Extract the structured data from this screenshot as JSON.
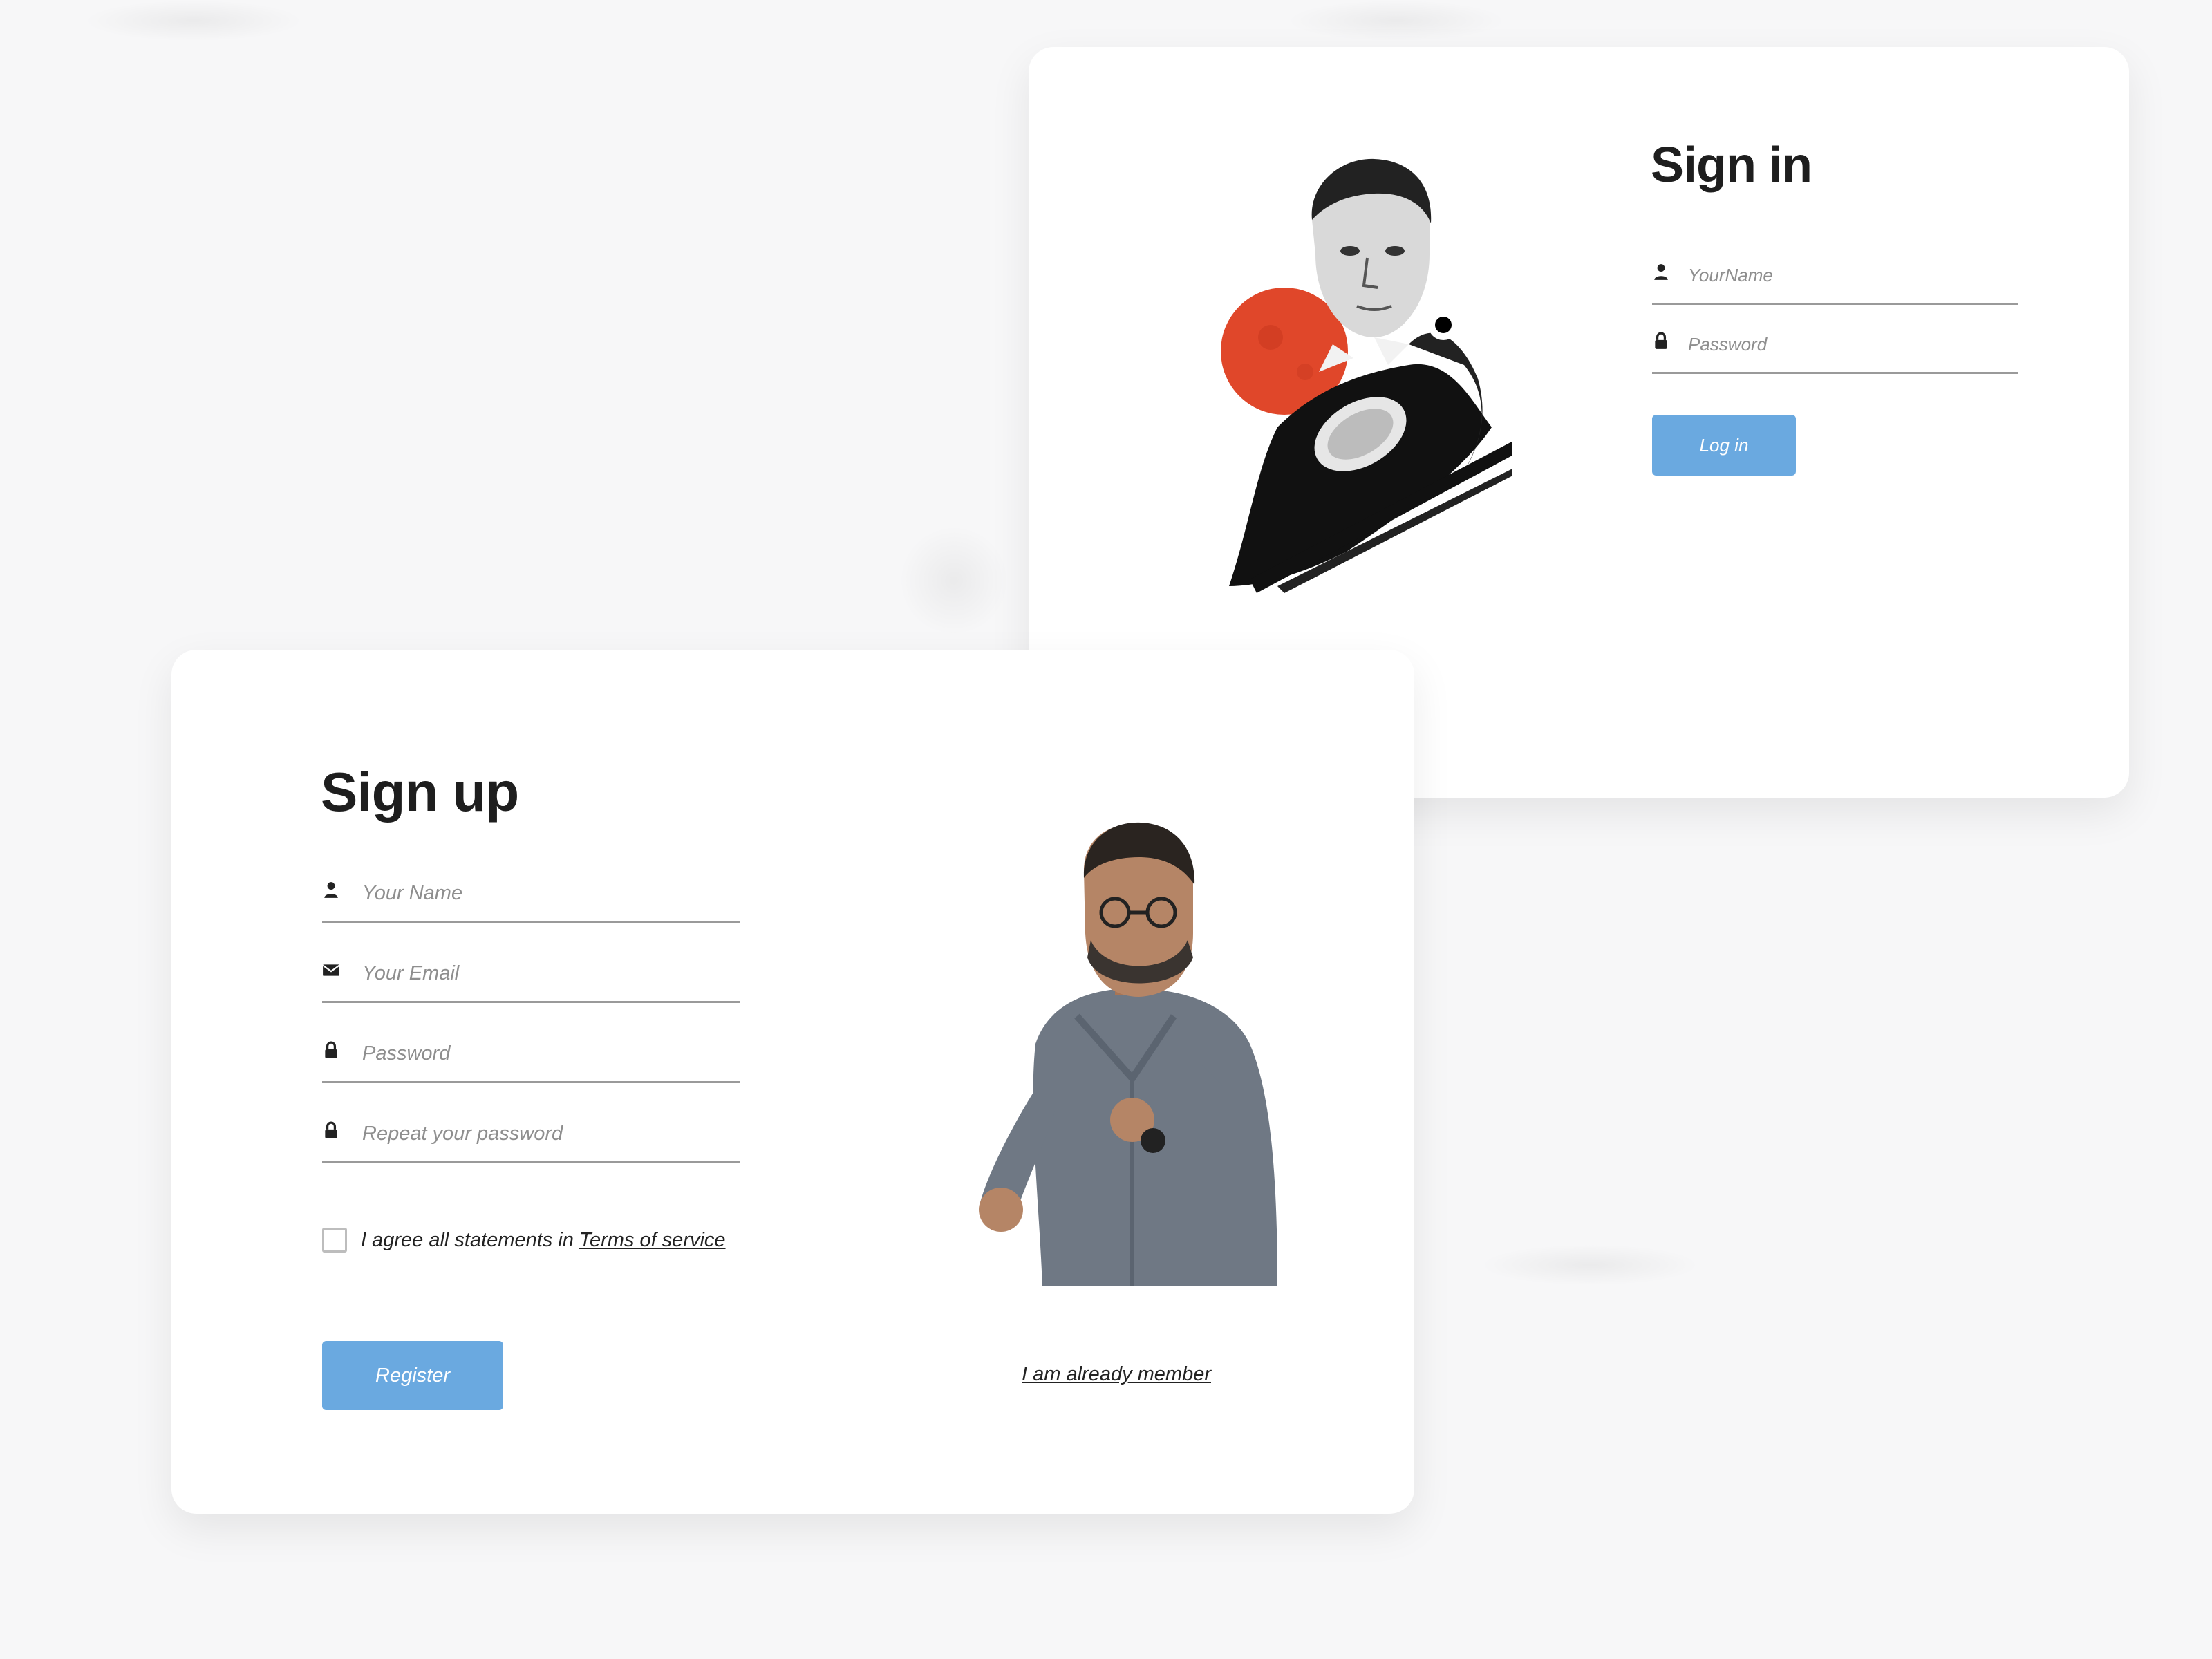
{
  "signin": {
    "title": "Sign in",
    "username_placeholder": "YourName",
    "password_placeholder": "Password",
    "login_label": "Log in",
    "icons": {
      "username": "user-icon",
      "password": "lock-icon"
    }
  },
  "signup": {
    "title": "Sign up",
    "name_placeholder": "Your Name",
    "email_placeholder": "Your Email",
    "password_placeholder": "Password",
    "repeat_password_placeholder": "Repeat your password",
    "agree_text": "I agree all statements in",
    "terms_link": "Terms of service",
    "register_label": "Register",
    "member_link": "I am already member",
    "icons": {
      "name": "user-icon",
      "email": "envelope-icon",
      "password": "lock-icon",
      "repeat": "lock-icon"
    }
  },
  "colors": {
    "accent": "#6aa9e0",
    "background": "#f7f7f8",
    "card": "#ffffff",
    "title": "#1e1e1e",
    "mars_red": "#e0472a"
  }
}
